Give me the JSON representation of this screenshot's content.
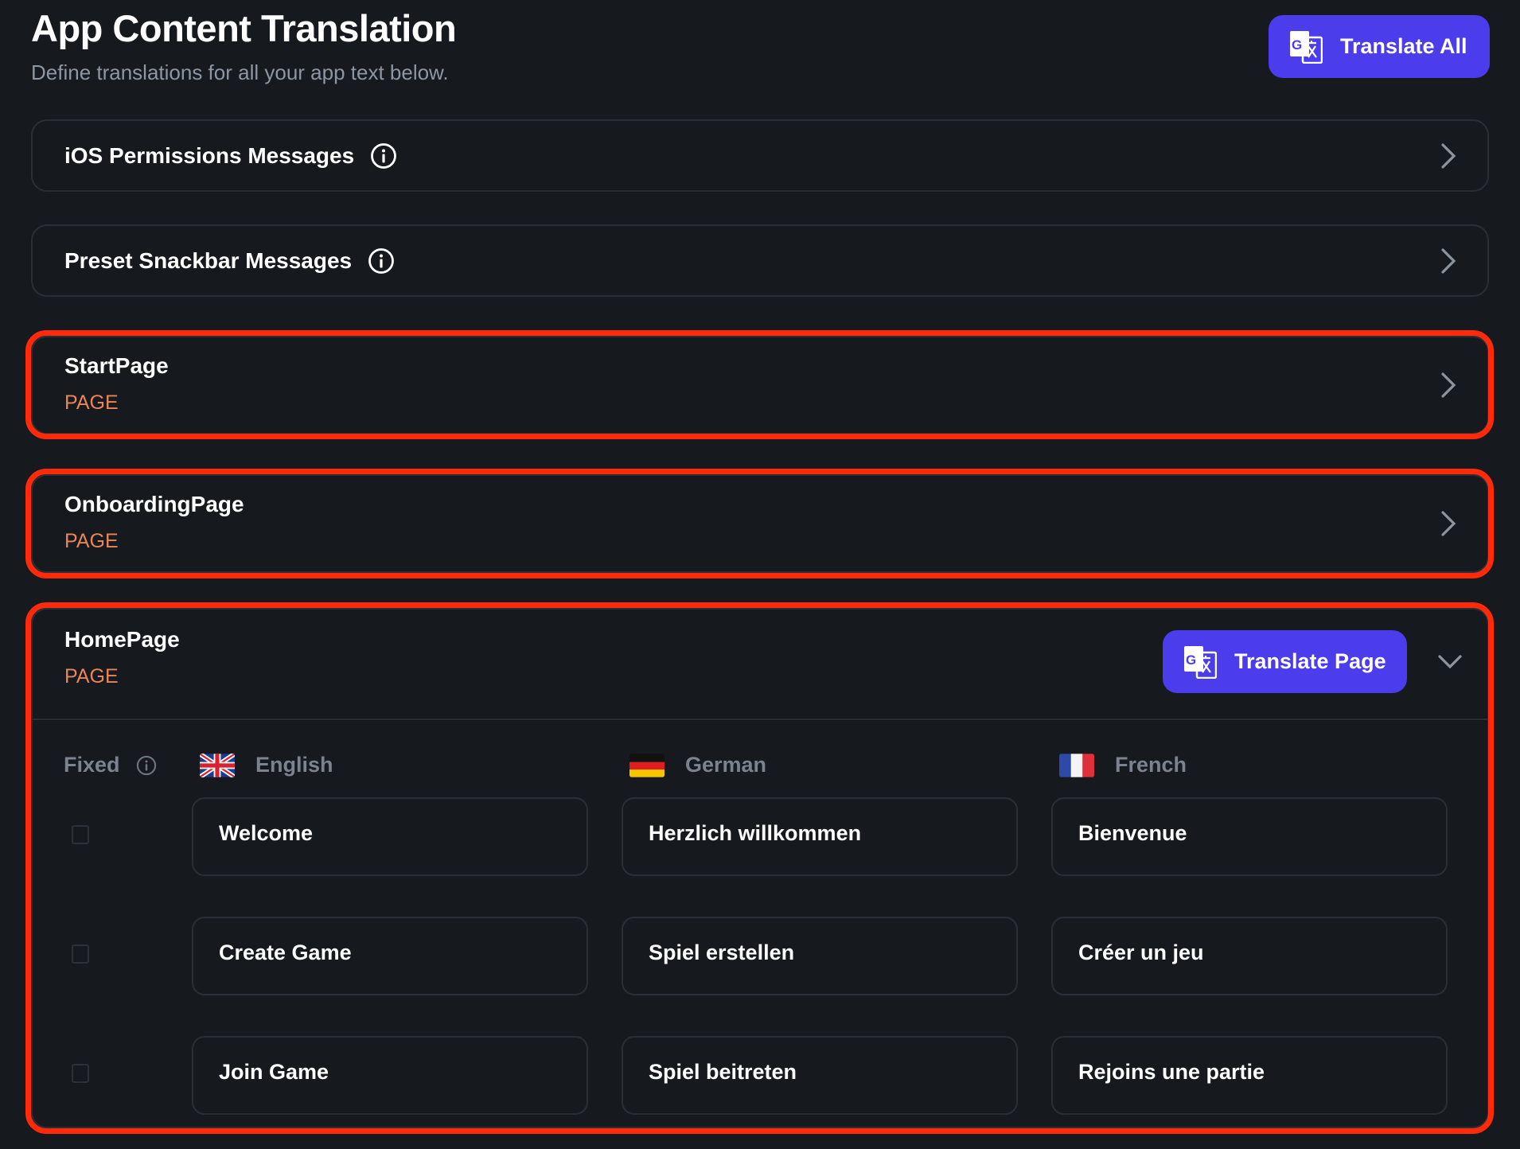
{
  "header": {
    "title": "App Content Translation",
    "subtitle": "Define translations for all your app text below.",
    "translate_all_label": "Translate All"
  },
  "sections": [
    {
      "label": "iOS Permissions Messages",
      "has_info": true,
      "state": "collapsed"
    },
    {
      "label": "Preset Snackbar Messages",
      "has_info": true,
      "state": "collapsed"
    }
  ],
  "pages": [
    {
      "name": "StartPage",
      "kind": "PAGE",
      "state": "collapsed",
      "highlighted": true
    },
    {
      "name": "OnboardingPage",
      "kind": "PAGE",
      "state": "collapsed",
      "highlighted": true
    },
    {
      "name": "HomePage",
      "kind": "PAGE",
      "state": "expanded",
      "highlighted": true,
      "translate_page_label": "Translate Page"
    }
  ],
  "table": {
    "fixed_label": "Fixed",
    "languages": [
      {
        "name": "English",
        "flag": "gb-flag"
      },
      {
        "name": "German",
        "flag": "de-flag"
      },
      {
        "name": "French",
        "flag": "fr-flag"
      }
    ],
    "rows": [
      {
        "fixed": false,
        "values": [
          "Welcome",
          "Herzlich willkommen",
          "Bienvenue"
        ]
      },
      {
        "fixed": false,
        "values": [
          "Create Game",
          "Spiel erstellen",
          "Créer un jeu"
        ]
      },
      {
        "fixed": false,
        "values": [
          "Join Game",
          "Spiel beitreten",
          "Rejoins une partie"
        ]
      }
    ]
  },
  "colors": {
    "background": "#16191d",
    "accent": "#4b3cec",
    "page_tag": "#ea8558",
    "highlight": "#ff2a0a",
    "border": "#2a2f37",
    "muted_text": "#8d96a5"
  }
}
